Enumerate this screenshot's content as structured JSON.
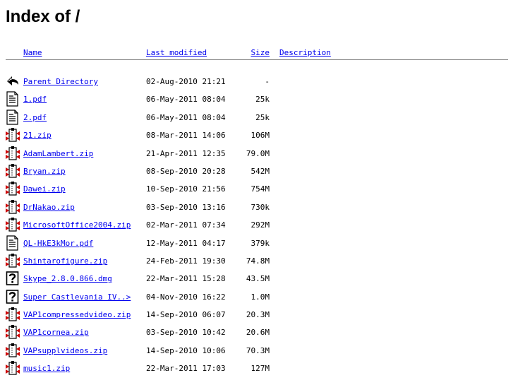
{
  "page": {
    "title": "Index of /"
  },
  "columns": {
    "name": "Name",
    "last_modified": "Last modified",
    "size": "Size",
    "description": "Description"
  },
  "entries": [
    {
      "icon": "back-icon",
      "name": "Parent Directory",
      "modified": "02-Aug-2010 21:21",
      "size": "-"
    },
    {
      "icon": "text-icon",
      "name": "1.pdf",
      "modified": "06-May-2011 08:04",
      "size": "25k"
    },
    {
      "icon": "text-icon",
      "name": "2.pdf",
      "modified": "06-May-2011 08:04",
      "size": "25k"
    },
    {
      "icon": "compressed-icon",
      "name": "21.zip",
      "modified": "08-Mar-2011 14:06",
      "size": "106M"
    },
    {
      "icon": "compressed-icon",
      "name": "AdamLambert.zip",
      "modified": "21-Apr-2011 12:35",
      "size": "79.0M"
    },
    {
      "icon": "compressed-icon",
      "name": "Bryan.zip",
      "modified": "08-Sep-2010 20:28",
      "size": "542M"
    },
    {
      "icon": "compressed-icon",
      "name": "Dawei.zip",
      "modified": "10-Sep-2010 21:56",
      "size": "754M"
    },
    {
      "icon": "compressed-icon",
      "name": "DrNakao.zip",
      "modified": "03-Sep-2010 13:16",
      "size": "730k"
    },
    {
      "icon": "compressed-icon",
      "name": "MicrosoftOffice2004.zip",
      "modified": "02-Mar-2011 07:34",
      "size": "292M"
    },
    {
      "icon": "text-icon",
      "name": "QL-HkE3kMor.pdf",
      "modified": "12-May-2011 04:17",
      "size": "379k"
    },
    {
      "icon": "compressed-icon",
      "name": "Shintarofigure.zip",
      "modified": "24-Feb-2011 19:30",
      "size": "74.8M"
    },
    {
      "icon": "unknown-icon",
      "name": "Skype_2.8.0.866.dmg",
      "modified": "22-Mar-2011 15:28",
      "size": "43.5M"
    },
    {
      "icon": "unknown-icon",
      "name": "Super Castlevania IV..>",
      "modified": "04-Nov-2010 16:22",
      "size": "1.0M"
    },
    {
      "icon": "compressed-icon",
      "name": "VAP1compressedvideo.zip",
      "modified": "14-Sep-2010 06:07",
      "size": "20.3M"
    },
    {
      "icon": "compressed-icon",
      "name": "VAP1cornea.zip",
      "modified": "03-Sep-2010 10:42",
      "size": "20.6M"
    },
    {
      "icon": "compressed-icon",
      "name": "VAPsupplvideos.zip",
      "modified": "14-Sep-2010 10:06",
      "size": "70.3M"
    },
    {
      "icon": "compressed-icon",
      "name": "music1.zip",
      "modified": "22-Mar-2011 17:03",
      "size": "127M"
    }
  ]
}
